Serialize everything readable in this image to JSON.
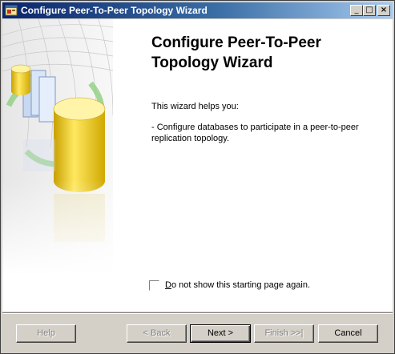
{
  "window": {
    "title": "Configure Peer-To-Peer Topology Wizard",
    "controls": {
      "minimize": "_",
      "maximize": "□",
      "close": "×"
    }
  },
  "page": {
    "heading_line1": "Configure Peer-To-Peer",
    "heading_line2": "Topology Wizard",
    "intro": "This wizard helps you:",
    "bullet": "- Configure databases to participate in a peer-to-peer replication topology."
  },
  "checkbox": {
    "label_accel": "D",
    "label_rest": "o not show this starting page again.",
    "checked": false
  },
  "buttons": {
    "help": "Help",
    "back": "< Back",
    "next": "Next >",
    "finish": "Finish >>|",
    "cancel": "Cancel"
  },
  "icons": {
    "app": "wizard-app-icon",
    "art": "database-replication-illustration"
  }
}
